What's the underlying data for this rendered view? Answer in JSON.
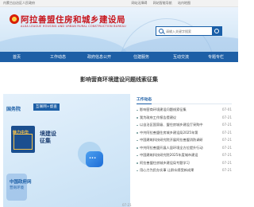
{
  "topbar": {
    "gov_link": "内蒙古自治区人民政府",
    "links": [
      "网站无障碍",
      "网站智能导航",
      "站内地图"
    ]
  },
  "banner": {
    "site_title": "阿拉善盟住房和城乡建设局",
    "site_subtitle": "ALXA LEAGUE HOUSING AND URBAN RURAL CONSTRUCTION BUREAU"
  },
  "search": {
    "placeholder": "请输入关键字搜索"
  },
  "nav": {
    "items": [
      "首页",
      "工作动态",
      "政府信息公开",
      "住建服务",
      "互动交流",
      "专题专栏"
    ]
  },
  "page": {
    "title": "影响营商环境建设问题线索征集"
  },
  "promo": {
    "council_tag": "国务院",
    "council_badge": "互联网+督查",
    "card_text": "魅力中华",
    "headline_line1": "境建设",
    "headline_line2": "征集",
    "app_tag": "中国政府网",
    "app_sub": "营商环境"
  },
  "notice": {
    "header": "工作动态",
    "items": [
      {
        "title": "影响营商环境建设问题线索征集",
        "date": "07-01"
      },
      {
        "title": "我为政府工作报告提建议",
        "date": "07-21"
      },
      {
        "title": "以自治区国家级、盟住房城乡建设厅采购中",
        "date": "07-21"
      },
      {
        "title": "中共阿拉善盟住房城乡建设局2025年第",
        "date": "07-21"
      },
      {
        "title": "中国建筑科技研究院开展阿拉善盟消防调研",
        "date": "07-21"
      },
      {
        "title": "中共阿拉善盟开展人居环境全方位提升行动",
        "date": "07-21"
      },
      {
        "title": "中国建筑科技研究院2025年度城市建设",
        "date": "07-21"
      },
      {
        "title": "阿拉善盟住房城乡建设局专题学习",
        "date": "07-21"
      },
      {
        "title": "用心力为民办实事 让群众感受新成果",
        "date": "07-21"
      }
    ]
  },
  "bottom_date": "07-21",
  "colors": {
    "brand_red": "#c8161d",
    "nav_blue": "#1d5fa6"
  }
}
